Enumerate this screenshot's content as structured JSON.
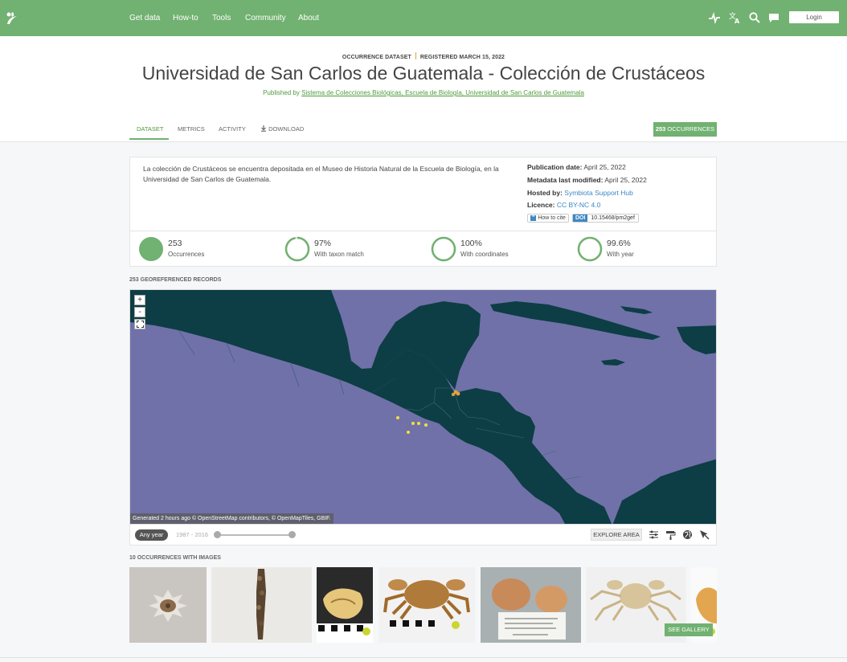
{
  "nav": {
    "links": [
      "Get data",
      "How-to",
      "Tools",
      "Community",
      "About"
    ],
    "login_label": "Login",
    "icons": [
      "pulse-icon",
      "translate-icon",
      "search-icon",
      "feedback-icon"
    ],
    "brand_color": "#71b171"
  },
  "header": {
    "type_label": "OCCURRENCE DATASET",
    "registered": "REGISTERED MARCH 15, 2022",
    "title": "Universidad de San Carlos de Guatemala - Colección de Crustáceos",
    "published_by_prefix": "Published by",
    "publisher": "Sistema de Colecciones Biológicas, Escuela de Biología, Universidad de San Carlos de Guatemala",
    "tabs": [
      "DATASET",
      "METRICS",
      "ACTIVITY",
      "DOWNLOAD"
    ],
    "active_tab": "DATASET",
    "occurrence_badge": {
      "count": "253",
      "label": "OCCURRENCES"
    }
  },
  "summary": {
    "description": "La colección de Crustáceos se encuentra depositada en el Museo de Historia Natural de la Escuela de Biología, en la Universidad de San Carlos de Guatemala.",
    "publication_date_label": "Publication date:",
    "publication_date": "April 25, 2022",
    "metadata_modified_label": "Metadata last modified:",
    "metadata_modified": "April 25, 2022",
    "hosted_by_label": "Hosted by:",
    "hosted_by": "Symbiota Support Hub",
    "licence_label": "Licence:",
    "licence": "CC BY-NC 4.0",
    "cite_label": "How to cite",
    "doi_label": "DOI",
    "doi": "10.15468/pm2gef"
  },
  "stats": [
    {
      "value": "253",
      "label": "Occurrences",
      "fraction": 1.0
    },
    {
      "value": "97%",
      "label": "With taxon match",
      "fraction": 0.97
    },
    {
      "value": "100%",
      "label": "With coordinates",
      "fraction": 1.0
    },
    {
      "value": "99.6%",
      "label": "With year",
      "fraction": 0.996
    }
  ],
  "map": {
    "section_label": "253 GEOREFERENCED RECORDS",
    "zoom_in": "+",
    "zoom_out": "-",
    "fullscreen": "⛶",
    "attribution": "Generated 2 hours ago © OpenStreetMap contributors, © OpenMapTiles, GBIF.",
    "year_filter": "Any year",
    "year_range": "1987 - 2016",
    "explore_label": "EXPLORE AREA",
    "tool_icons": [
      "filter-icon",
      "style-icon",
      "globe-icon",
      "select-icon"
    ],
    "ocean_color": "#7071a8",
    "land_color": "#0d3d45"
  },
  "gallery": {
    "section_label": "10 OCCURRENCES WITH IMAGES",
    "see_gallery": "SEE GALLERY"
  }
}
